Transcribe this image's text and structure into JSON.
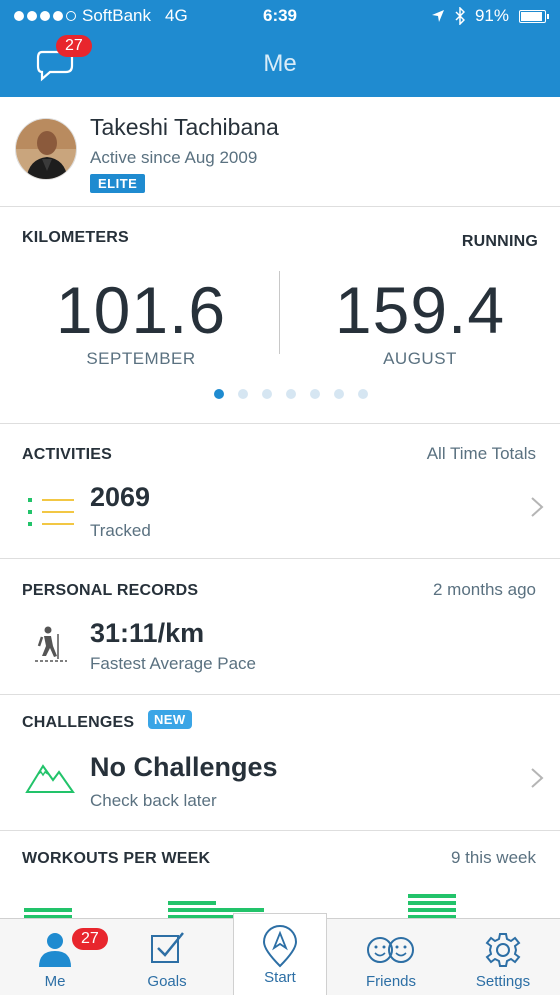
{
  "status_bar": {
    "carrier": "SoftBank",
    "network": "4G",
    "time": "6:39",
    "battery": "91%",
    "battery_level": 0.91
  },
  "header": {
    "title": "Me",
    "message_count": "27"
  },
  "profile": {
    "name": "Takeshi Tachibana",
    "active_since": "Active since Aug 2009",
    "badge": "ELITE"
  },
  "kilometers": {
    "title": "KILOMETERS",
    "activity_type": "RUNNING",
    "stats": [
      {
        "value": "101.6",
        "label": "SEPTEMBER"
      },
      {
        "value": "159.4",
        "label": "AUGUST"
      }
    ],
    "page_count": 7,
    "active_page": 0
  },
  "activities": {
    "title": "ACTIVITIES",
    "meta": "All Time Totals",
    "value": "2069",
    "caption": "Tracked",
    "icon": "list-icon"
  },
  "personal_records": {
    "title": "PERSONAL RECORDS",
    "meta": "2 months ago",
    "value": "31:11/km",
    "caption": "Fastest Average Pace",
    "icon": "hiker-icon"
  },
  "challenges": {
    "title": "CHALLENGES",
    "new_badge": "NEW",
    "value": "No Challenges",
    "caption": "Check back later",
    "icon": "mountain-icon"
  },
  "workouts_per_week": {
    "title": "WORKOUTS PER WEEK",
    "meta": "9 this week",
    "weeks": [
      2,
      0,
      0,
      3,
      2,
      1,
      0,
      0,
      4,
      0,
      0
    ],
    "color": "#22c36a"
  },
  "tabbar": {
    "tabs": [
      {
        "label": "Me",
        "badge": "27",
        "icon": "person-icon"
      },
      {
        "label": "Goals",
        "icon": "checkbox-icon"
      },
      {
        "label": "Start",
        "icon": "location-pin-icon"
      },
      {
        "label": "Friends",
        "icon": "smiley-faces-icon"
      },
      {
        "label": "Settings",
        "icon": "gear-icon"
      }
    ]
  },
  "colors": {
    "brand_blue": "#1f8bd0",
    "badge_red": "#e8262d",
    "text_dark": "#27313a",
    "text_muted": "#5a7180",
    "accent_green": "#22c36a"
  }
}
